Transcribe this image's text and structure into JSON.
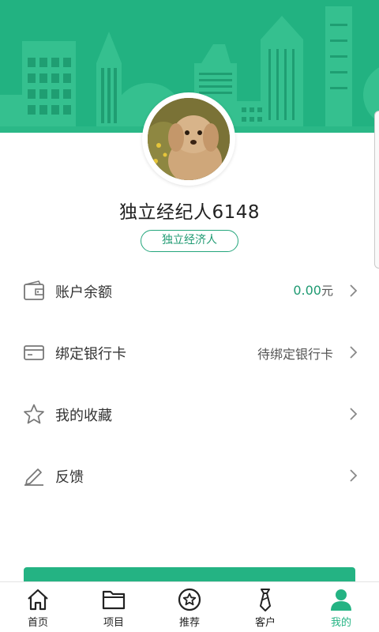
{
  "colors": {
    "brand": "#24b383",
    "accent_text": "#1f9a72"
  },
  "profile": {
    "username": "独立经纪人6148",
    "role": "独立经济人"
  },
  "menu": [
    {
      "label": "账户余额",
      "value": "0.00",
      "unit": "元",
      "icon": "wallet-icon"
    },
    {
      "label": "绑定银行卡",
      "value": "待绑定银行卡",
      "icon": "bank-card-icon"
    },
    {
      "label": "我的收藏",
      "value": "",
      "icon": "star-icon"
    },
    {
      "label": "反馈",
      "value": "",
      "icon": "edit-icon"
    }
  ],
  "nav": [
    {
      "label": "首页",
      "icon": "home-icon",
      "active": false
    },
    {
      "label": "项目",
      "icon": "folder-icon",
      "active": false
    },
    {
      "label": "推荐",
      "icon": "recommend-star-icon",
      "active": false
    },
    {
      "label": "客户",
      "icon": "client-tie-icon",
      "active": false
    },
    {
      "label": "我的",
      "icon": "person-icon",
      "active": true
    }
  ]
}
